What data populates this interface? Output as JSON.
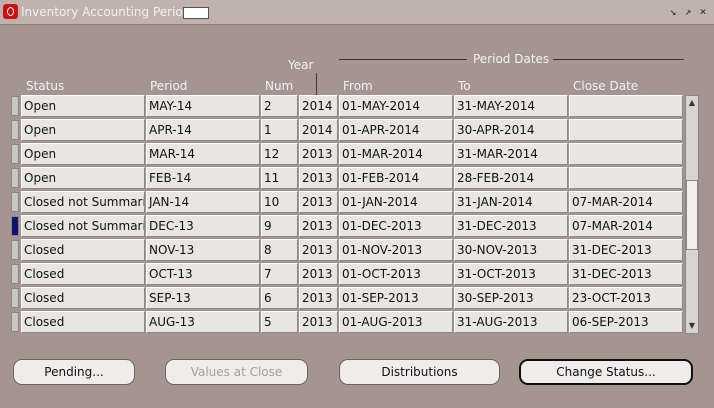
{
  "window": {
    "title": "Inventory Accounting Periods",
    "controls": [
      "minimize-icon",
      "restore-icon",
      "close-icon"
    ]
  },
  "columns": {
    "status": "Status",
    "period": "Period",
    "year": "Year",
    "num": "Num",
    "period_dates": "Period Dates",
    "from": "From",
    "to": "To",
    "close_date": "Close Date"
  },
  "rows": [
    {
      "status": "Open",
      "period": "MAY-14",
      "num": "2",
      "year": "2014",
      "from": "01-MAY-2014",
      "to": "31-MAY-2014",
      "close_date": ""
    },
    {
      "status": "Open",
      "period": "APR-14",
      "num": "1",
      "year": "2014",
      "from": "01-APR-2014",
      "to": "30-APR-2014",
      "close_date": ""
    },
    {
      "status": "Open",
      "period": "MAR-14",
      "num": "12",
      "year": "2013",
      "from": "01-MAR-2014",
      "to": "31-MAR-2014",
      "close_date": ""
    },
    {
      "status": "Open",
      "period": "FEB-14",
      "num": "11",
      "year": "2013",
      "from": "01-FEB-2014",
      "to": "28-FEB-2014",
      "close_date": ""
    },
    {
      "status": "Closed not Summari",
      "period": "JAN-14",
      "num": "10",
      "year": "2013",
      "from": "01-JAN-2014",
      "to": "31-JAN-2014",
      "close_date": "07-MAR-2014"
    },
    {
      "status": "Closed not Summari",
      "period": "DEC-13",
      "num": "9",
      "year": "2013",
      "from": "01-DEC-2013",
      "to": "31-DEC-2013",
      "close_date": "07-MAR-2014"
    },
    {
      "status": "Closed",
      "period": "NOV-13",
      "num": "8",
      "year": "2013",
      "from": "01-NOV-2013",
      "to": "30-NOV-2013",
      "close_date": "31-DEC-2013"
    },
    {
      "status": "Closed",
      "period": "OCT-13",
      "num": "7",
      "year": "2013",
      "from": "01-OCT-2013",
      "to": "31-OCT-2013",
      "close_date": "31-DEC-2013"
    },
    {
      "status": "Closed",
      "period": "SEP-13",
      "num": "6",
      "year": "2013",
      "from": "01-SEP-2013",
      "to": "30-SEP-2013",
      "close_date": "23-OCT-2013"
    },
    {
      "status": "Closed",
      "period": "AUG-13",
      "num": "5",
      "year": "2013",
      "from": "01-AUG-2013",
      "to": "31-AUG-2013",
      "close_date": "06-SEP-2013"
    }
  ],
  "selected_row_number": 6,
  "buttons": {
    "pending": "Pending...",
    "values_at_close": "Values at Close",
    "distributions": "Distributions",
    "change_status": "Change Status..."
  },
  "colors": {
    "window_bg": "#a59590",
    "cell_bg": "#e8e6e3",
    "selected_indicator": "#10106e",
    "app_icon": "#cc1111"
  }
}
